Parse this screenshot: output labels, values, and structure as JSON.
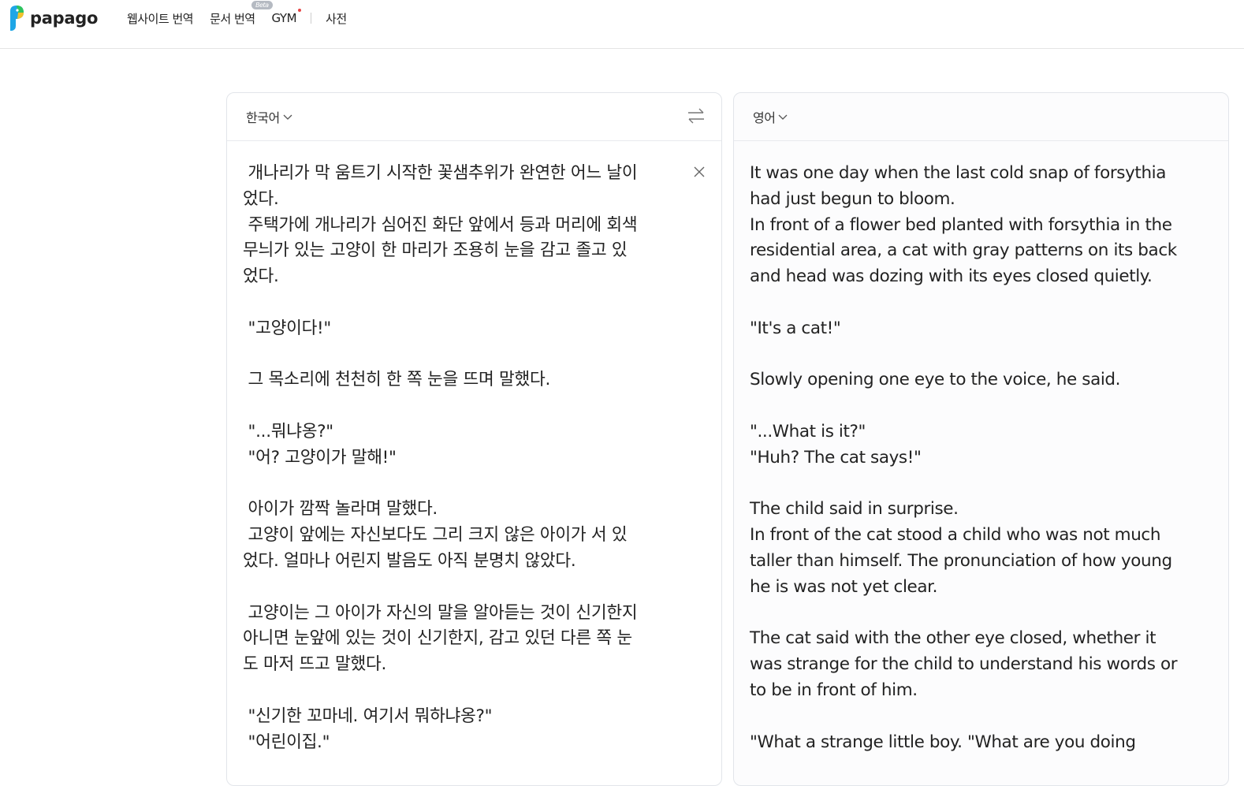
{
  "app": {
    "logo_text": "papago",
    "brand_colors": {
      "parrot_blue": "#1ea6e6",
      "parrot_green": "#2fc45c",
      "parrot_yellow": "#f2c22b"
    }
  },
  "nav": {
    "items": [
      {
        "label": "웹사이트 번역",
        "icon": null
      },
      {
        "label": "문서 번역",
        "badge": "Beta"
      },
      {
        "label": "GYM",
        "dot_color": "#e64545"
      },
      {
        "label": "사전"
      }
    ]
  },
  "source": {
    "language": "한국어",
    "text_lines": [
      " 개나리가 막 움트기 시작한 꽃샘추위가 완연한 어느 날이",
      "었다.",
      " 주택가에 개나리가 심어진 화단 앞에서 등과 머리에 회색",
      "무늬가 있는 고양이 한 마리가 조용히 눈을 감고 졸고 있",
      "었다.",
      "",
      " \"고양이다!\"",
      "",
      " 그 목소리에 천천히 한 쪽 눈을 뜨며 말했다.",
      "",
      " \"...뭐냐옹?\"",
      " \"어? 고양이가 말해!\"",
      "",
      " 아이가 깜짝 놀라며 말했다.",
      " 고양이 앞에는 자신보다도 그리 크지 않은 아이가 서 있",
      "었다. 얼마나 어린지 발음도 아직 분명치 않았다.",
      "",
      " 고양이는 그 아이가 자신의 말을 알아듣는 것이 신기한지",
      "아니면 눈앞에 있는 것이 신기한지, 감고 있던 다른 쪽 눈",
      "도 마저 뜨고 말했다.",
      "",
      " \"신기한 꼬마네. 여기서 뭐하냐옹?\"",
      " \"어린이집.\""
    ]
  },
  "target": {
    "language": "영어",
    "text_lines": [
      "It was one day when the last cold snap of forsythia",
      "had just begun to bloom.",
      "In front of a flower bed planted with forsythia in the",
      "residential area, a cat with gray patterns on its back",
      "and head was dozing with its eyes closed quietly.",
      "",
      "\"It's a cat!\"",
      "",
      "Slowly opening one eye to the voice, he said.",
      "",
      "\"...What is it?\"",
      "\"Huh? The cat says!\"",
      "",
      "The child said in surprise.",
      "In front of the cat stood a child who was not much",
      "taller than himself. The pronunciation of how young",
      "he is was not yet clear.",
      "",
      "The cat said with the other eye closed, whether it",
      "was strange for the child to understand his words or",
      "to be in front of him.",
      "",
      "\"What a strange little boy. \"What are you doing"
    ]
  }
}
